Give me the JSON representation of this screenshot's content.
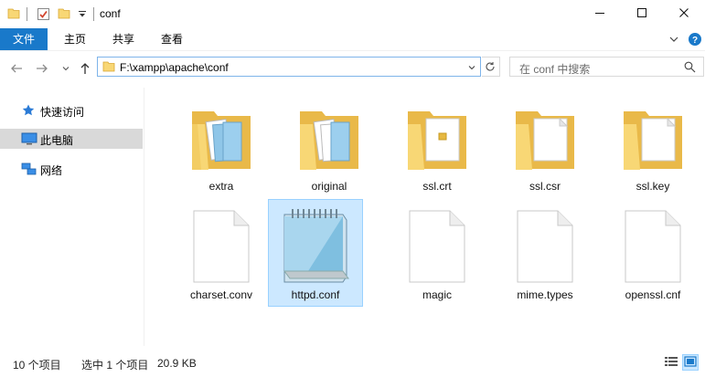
{
  "window": {
    "title": "conf",
    "minimize_icon": "minimize-icon",
    "maximize_icon": "maximize-icon",
    "close_icon": "close-icon"
  },
  "ribbon": {
    "tabs": [
      {
        "label": "文件"
      },
      {
        "label": "主页"
      },
      {
        "label": "共享"
      },
      {
        "label": "查看"
      }
    ]
  },
  "address": {
    "path": "F:\\xampp\\apache\\conf"
  },
  "search": {
    "placeholder": "在 conf 中搜索"
  },
  "nav": {
    "items": [
      {
        "label": "快速访问",
        "icon": "star-icon"
      },
      {
        "label": "此电脑",
        "icon": "computer-icon"
      },
      {
        "label": "网络",
        "icon": "network-icon"
      }
    ]
  },
  "files": [
    {
      "name": "extra",
      "type": "folder-with-files"
    },
    {
      "name": "original",
      "type": "folder-with-files"
    },
    {
      "name": "ssl.crt",
      "type": "folder-with-file"
    },
    {
      "name": "ssl.csr",
      "type": "folder-with-doc"
    },
    {
      "name": "ssl.key",
      "type": "folder-with-doc"
    },
    {
      "name": "charset.conv",
      "type": "file"
    },
    {
      "name": "httpd.conf",
      "type": "notepad",
      "selected": true
    },
    {
      "name": "magic",
      "type": "file"
    },
    {
      "name": "mime.types",
      "type": "file"
    },
    {
      "name": "openssl.cnf",
      "type": "file"
    }
  ],
  "status": {
    "item_count": "10 个项目",
    "selection": "选中 1 个项目",
    "size": "20.9 KB"
  },
  "colors": {
    "accent": "#1979ca",
    "selection_bg": "#cce8ff",
    "selection_border": "#99d1ff",
    "folder": "#f8d775"
  }
}
